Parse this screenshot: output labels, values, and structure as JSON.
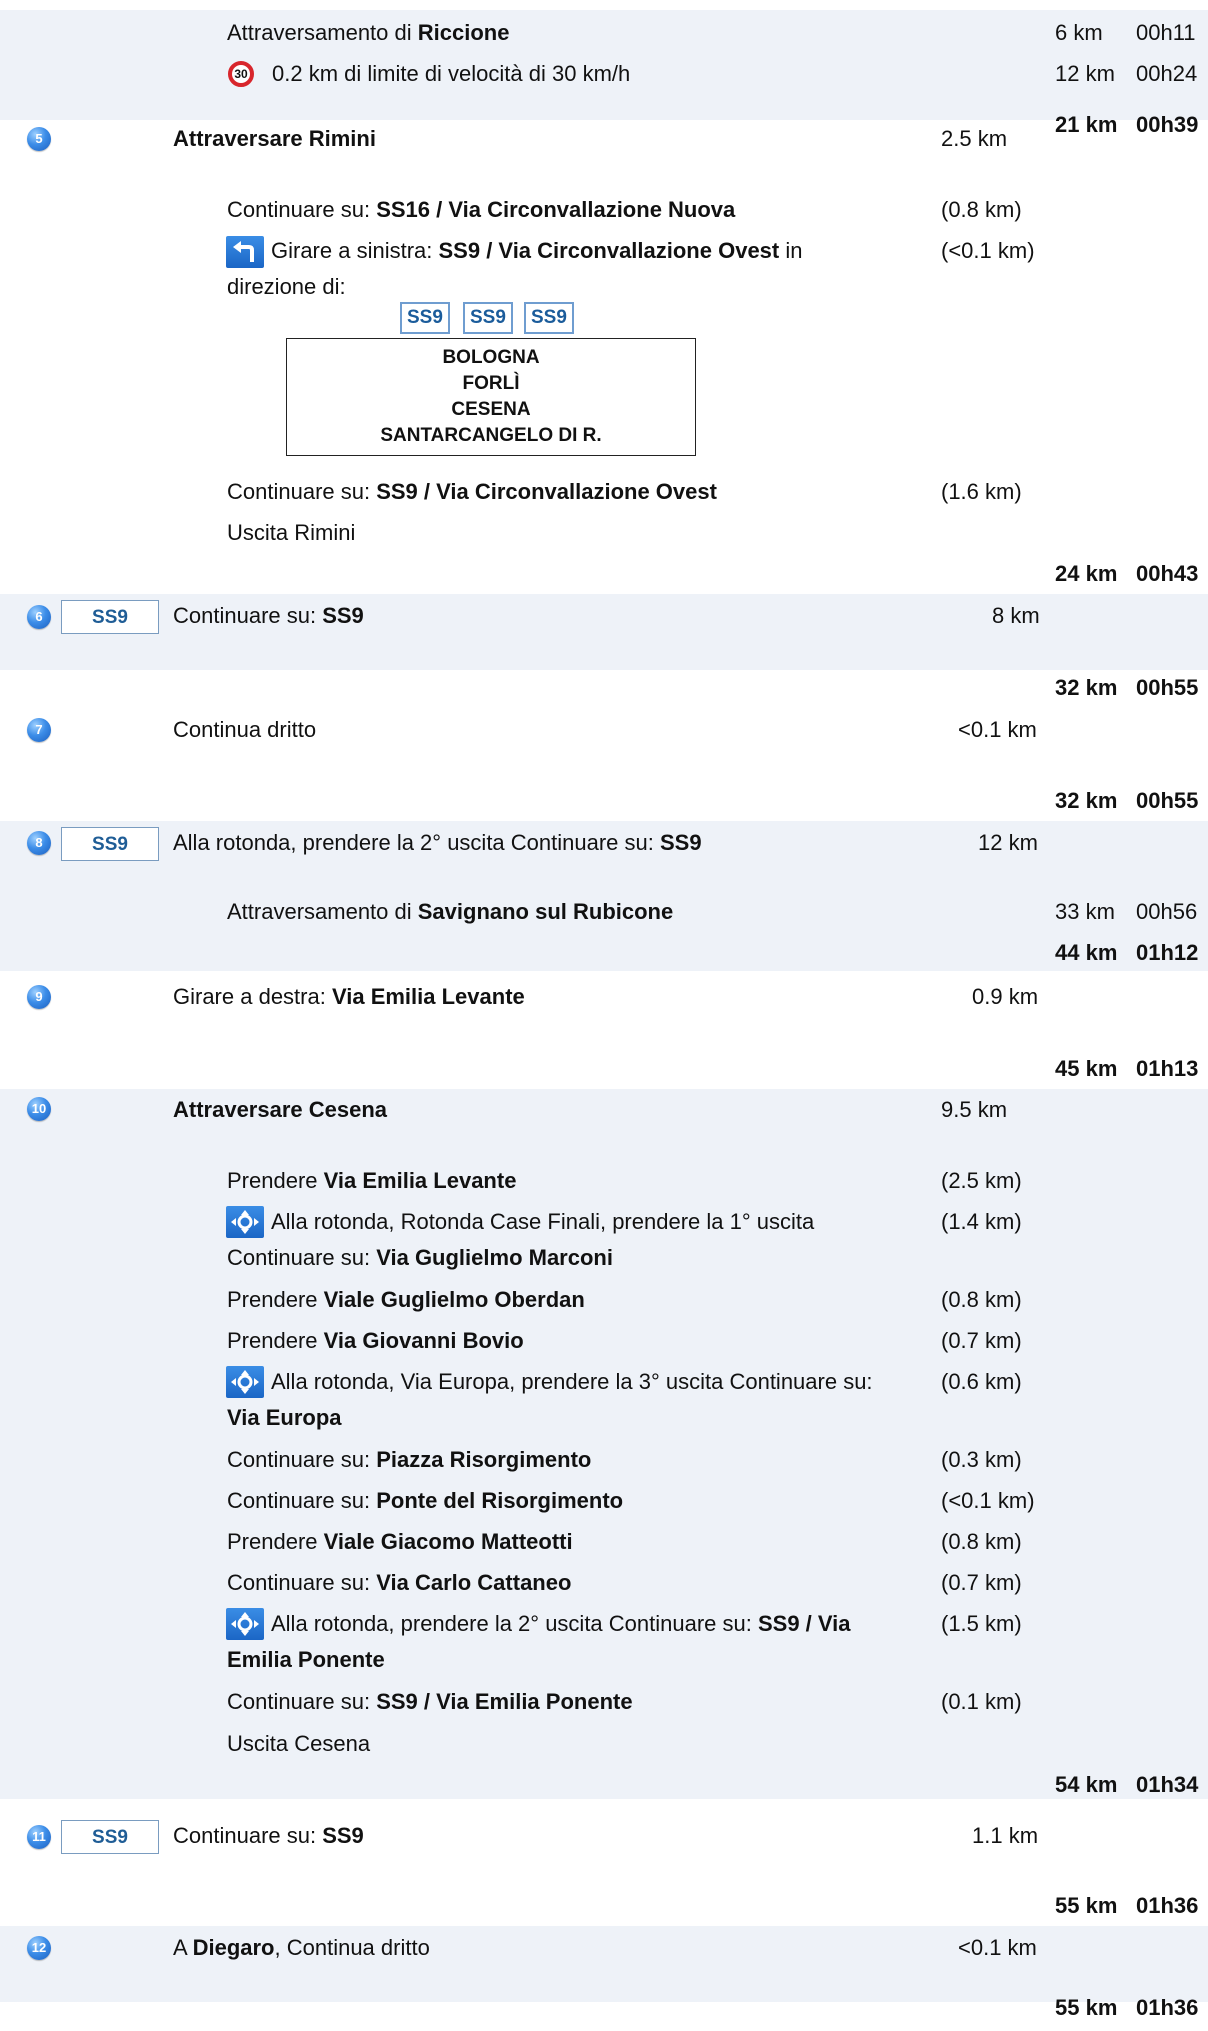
{
  "rows": {
    "riccione": {
      "prefix": "Attraversamento di ",
      "place": "Riccione",
      "dist": "6 km",
      "time": "00h11"
    },
    "speed": {
      "limit": "30",
      "text": "0.2 km di limite di velocità di 30 km/h",
      "dist": "12 km",
      "time": "00h24"
    }
  },
  "step5": {
    "number": "5",
    "title": "Attraversare Rimini",
    "dist": "2.5 km",
    "cum_dist": "21 km",
    "cum_time": "00h39",
    "i1": {
      "label": "Continuare su: ",
      "road": "SS16 / Via Circonvallazione Nuova",
      "dist": "(0.8 km)"
    },
    "i2": {
      "label": "Girare a sinistra: ",
      "road": "SS9 / Via Circonvallazione Ovest",
      "after": " in",
      "line2": "direzione di:",
      "dist": "(<0.1 km)"
    },
    "chips": [
      "SS9",
      "SS9",
      "SS9"
    ],
    "destinations": [
      "BOLOGNA",
      "FORLÌ",
      "CESENA",
      "SANTARCANGELO DI R."
    ],
    "i3": {
      "label": "Continuare su: ",
      "road": "SS9 / Via Circonvallazione Ovest",
      "dist": "(1.6 km)"
    },
    "exit": "Uscita Rimini"
  },
  "step6": {
    "number": "6",
    "road": "SS9",
    "label": "Continuare su: ",
    "target": "SS9",
    "dist": "8 km",
    "cum_dist": "24 km",
    "cum_time": "00h43"
  },
  "step7": {
    "number": "7",
    "text": "Continua dritto",
    "dist": "<0.1 km",
    "cum_dist": "32 km",
    "cum_time": "00h55"
  },
  "step8": {
    "number": "8",
    "road": "SS9",
    "label": "Alla rotonda, prendere la 2° uscita Continuare su: ",
    "target": "SS9",
    "dist": "12 km",
    "cum_dist": "32 km",
    "cum_time": "00h55",
    "sub": {
      "prefix": "Attraversamento di ",
      "place": "Savignano sul Rubicone",
      "dist": "33 km",
      "time": "00h56"
    }
  },
  "step9": {
    "number": "9",
    "label": "Girare a destra: ",
    "target": "Via Emilia Levante",
    "dist": "0.9 km",
    "cum_dist": "44 km",
    "cum_time": "01h12"
  },
  "step10": {
    "number": "10",
    "title": "Attraversare Cesena",
    "dist": "9.5 km",
    "cum_dist": "45 km",
    "cum_time": "01h13",
    "i1": {
      "label": "Prendere ",
      "road": "Via Emilia Levante",
      "dist": "(2.5 km)"
    },
    "i2": {
      "line1": "Alla rotonda, Rotonda Case Finali, prendere la 1° uscita",
      "label2": "Continuare su: ",
      "road": "Via Guglielmo Marconi",
      "dist": "(1.4 km)"
    },
    "i3": {
      "label": "Prendere ",
      "road": "Viale Guglielmo Oberdan",
      "dist": "(0.8 km)"
    },
    "i4": {
      "label": "Prendere ",
      "road": "Via Giovanni Bovio",
      "dist": "(0.7 km)"
    },
    "i5": {
      "line1": "Alla rotonda, Via Europa, prendere la 3° uscita Continuare su:",
      "road": "Via Europa",
      "dist": "(0.6 km)"
    },
    "i6": {
      "label": "Continuare su: ",
      "road": "Piazza Risorgimento",
      "dist": "(0.3 km)"
    },
    "i7": {
      "label": "Continuare su: ",
      "road": "Ponte del Risorgimento",
      "dist": "(<0.1 km)"
    },
    "i8": {
      "label": "Prendere ",
      "road": "Viale Giacomo Matteotti",
      "dist": "(0.8 km)"
    },
    "i9": {
      "label": "Continuare su: ",
      "road": "Via Carlo Cattaneo",
      "dist": "(0.7 km)"
    },
    "i10": {
      "line1": "Alla rotonda, prendere la 2° uscita Continuare su: ",
      "road1": "SS9 / Via",
      "road2": "Emilia Ponente",
      "dist": "(1.5 km)"
    },
    "i11": {
      "label": "Continuare su: ",
      "road": "SS9 / Via Emilia Ponente",
      "dist": "(0.1 km)"
    },
    "exit": "Uscita Cesena"
  },
  "step11": {
    "number": "11",
    "road": "SS9",
    "label": "Continuare su: ",
    "target": "SS9",
    "dist": "1.1 km",
    "cum_dist": "54 km",
    "cum_time": "01h34"
  },
  "step12": {
    "number": "12",
    "prefix": "A ",
    "place": "Diegaro",
    "suffix": ", Continua dritto",
    "dist": "<0.1 km",
    "cum_dist": "55 km",
    "cum_time": "01h36"
  },
  "final": {
    "cum_dist": "55 km",
    "cum_time": "01h36"
  },
  "icons": {
    "turn": "turn-left-icon",
    "roundabout": "roundabout-icon",
    "speed": "speed-limit-icon",
    "step": "step-number-icon"
  }
}
